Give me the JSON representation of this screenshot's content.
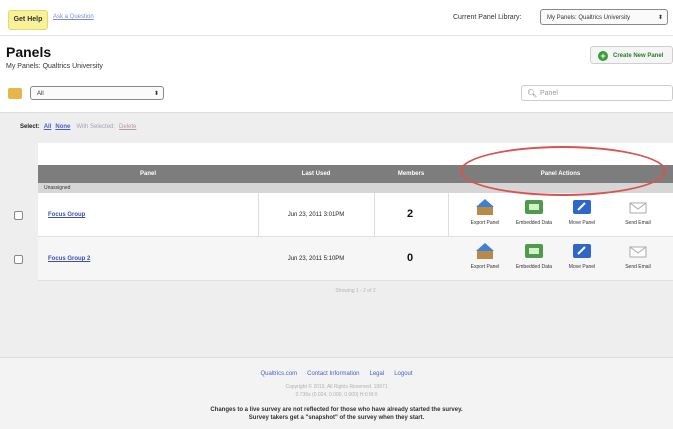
{
  "header": {
    "get_help": "Get Help",
    "ask_question": "Ask a Question",
    "library_label": "Current Panel Library:",
    "library_value": "My Panels: Qualtrics University"
  },
  "page": {
    "title": "Panels",
    "subtitle": "My Panels: Qualtrics University",
    "create_button": "Create New Panel"
  },
  "filter": {
    "value": "All",
    "search_placeholder": "Panel"
  },
  "select_bar": {
    "label": "Select:",
    "all": "All",
    "none": "None",
    "with_selected": "With Selected:",
    "delete": "Delete"
  },
  "table": {
    "columns": [
      "Panel",
      "Last Used",
      "Members",
      "Panel Actions"
    ],
    "group": "Unassigned",
    "rows": [
      {
        "name": "Focus Group",
        "last_used": "Jun 23, 2011 3:01PM",
        "members": "2"
      },
      {
        "name": "Focus Group 2",
        "last_used": "Jun 23, 2011 5:10PM",
        "members": "0"
      }
    ],
    "actions": [
      "Export Panel",
      "Embedded Data",
      "Move Panel",
      "Send Email"
    ],
    "showing": "Showing 1 - 2 of 2"
  },
  "footer": {
    "links": [
      "Qualtrics.com",
      "Contact Information",
      "Legal",
      "Logout"
    ],
    "copyright": "Copyright © 2013, All Rights Reserved. 19971",
    "timing": "0.736s (0.024, 0.000, 0.000) H:0 M:0",
    "note_line1": "Changes to a live survey are not reflected for those who have already started the survey.",
    "note_line2": "Survey takers get a \"snapshot\" of the survey when they start."
  },
  "colors": {
    "accent_link": "#3b4fb0",
    "header_bar": "#7d7d7d",
    "highlight_ellipse": "#d9534f",
    "create_green": "#3a9d3a"
  }
}
